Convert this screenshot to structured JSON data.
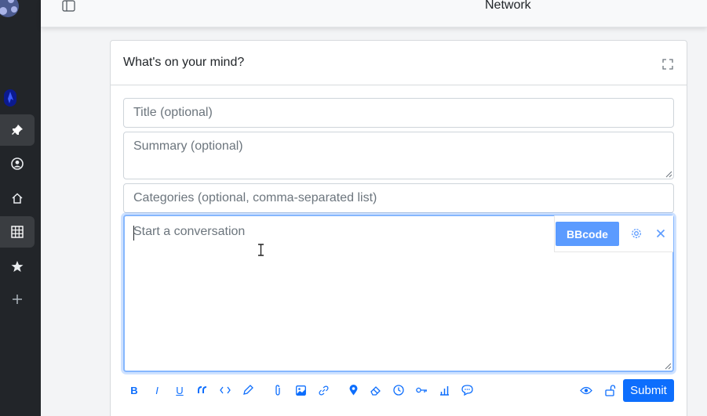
{
  "topbar": {
    "title": "Network"
  },
  "composer": {
    "header": "What's on your mind?",
    "title_placeholder": "Title (optional)",
    "summary_placeholder": "Summary (optional)",
    "categories_placeholder": "Categories (optional, comma-separated list)",
    "body_placeholder": "Start a conversation",
    "mode_button": "BBcode",
    "submit_label": "Submit"
  },
  "sidebar": {
    "items": [
      {
        "icon": "pin-icon",
        "active": true
      },
      {
        "icon": "user-circle-icon",
        "active": false
      },
      {
        "icon": "home-icon",
        "active": false
      },
      {
        "icon": "grid-icon",
        "active": true
      },
      {
        "icon": "star-icon",
        "active": false
      },
      {
        "icon": "plus-icon",
        "active": false
      }
    ]
  },
  "toolbar": {
    "icons": [
      "bold-icon",
      "italic-icon",
      "underline-icon",
      "quote-icon",
      "code-icon",
      "pencil-icon",
      "paperclip-icon",
      "image-icon",
      "link-icon",
      "location-pin-icon",
      "eraser-icon",
      "clock-icon",
      "key-icon",
      "bar-chart-icon",
      "comment-icon",
      "eye-icon",
      "unlock-icon"
    ],
    "bold_glyph": "B",
    "italic_glyph": "I",
    "underline_glyph": "U"
  },
  "colors": {
    "accent": "#0d6efd",
    "bbcode": "#5b9bff",
    "sidebar": "#222529"
  }
}
